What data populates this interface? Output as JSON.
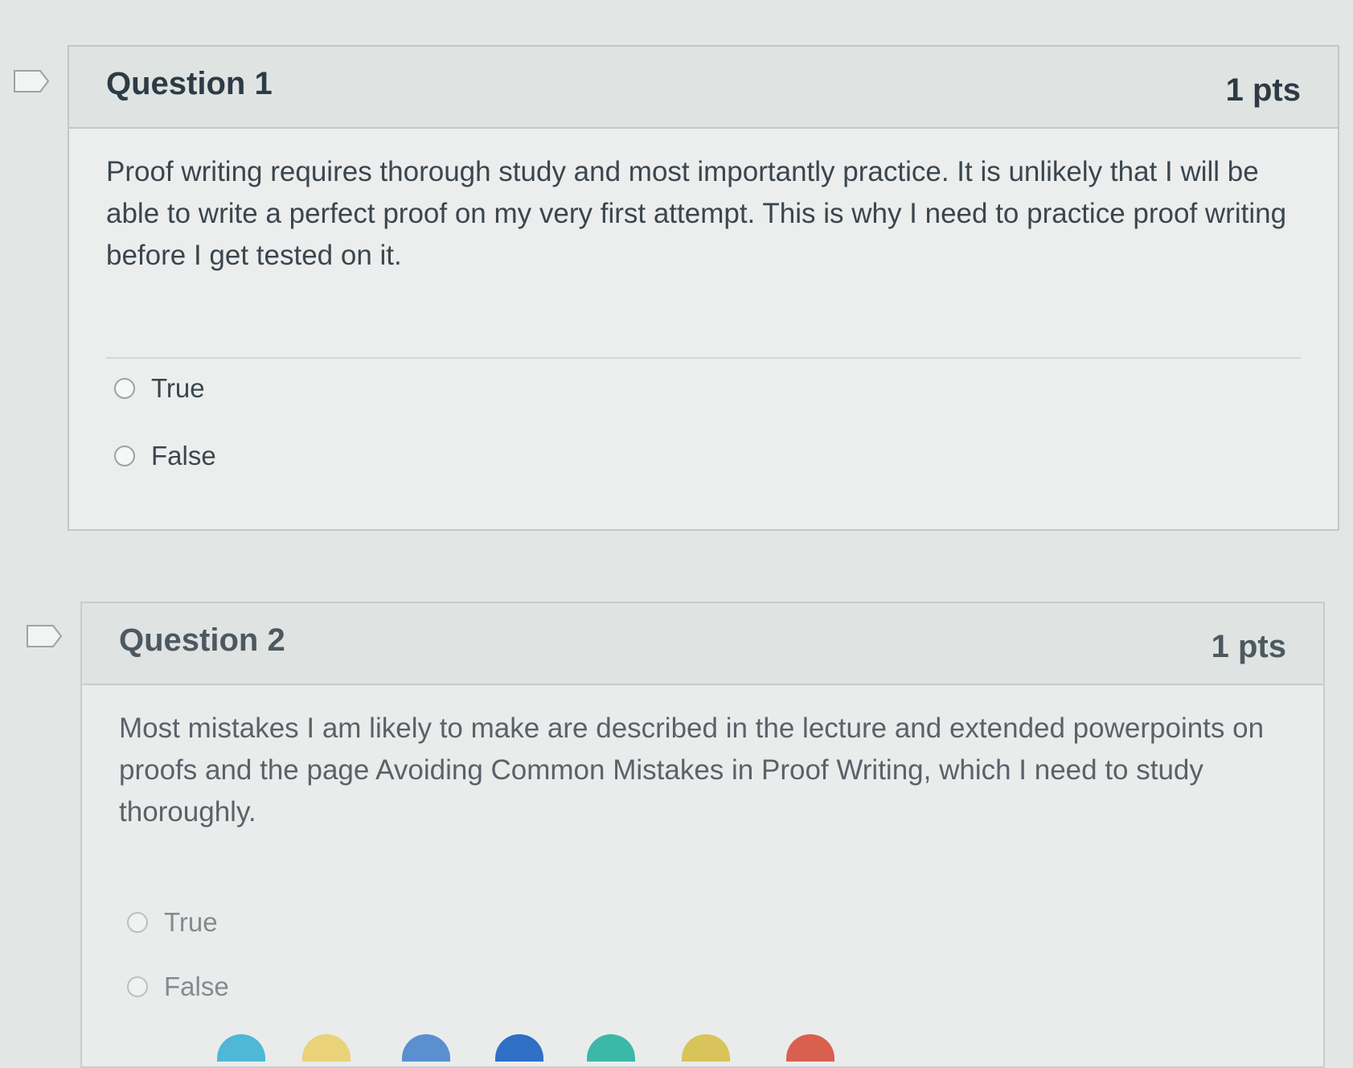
{
  "questions": [
    {
      "title": "Question 1",
      "points": "1 pts",
      "text": "Proof writing requires thorough study and most importantly practice. It is unlikely that I will be able to write a perfect proof on my very first attempt. This is why I need to practice proof writing before I get tested on it.",
      "answers": [
        "True",
        "False"
      ]
    },
    {
      "title": "Question 2",
      "points": "1 pts",
      "text": "Most mistakes I am likely to make are described in the lecture and extended powerpoints on proofs and the page Avoiding Common Mistakes in Proof Writing, which I need to study thoroughly.",
      "answers": [
        "True",
        "False"
      ]
    }
  ],
  "icons": {
    "flag": "bookmark-flag-icon",
    "radio": "radio-unselected-icon"
  },
  "colors": {
    "page_background": "#e4e6e5",
    "header_background": "#dfe3e2",
    "border": "#c2c7c9",
    "text": "#2d3b45"
  }
}
